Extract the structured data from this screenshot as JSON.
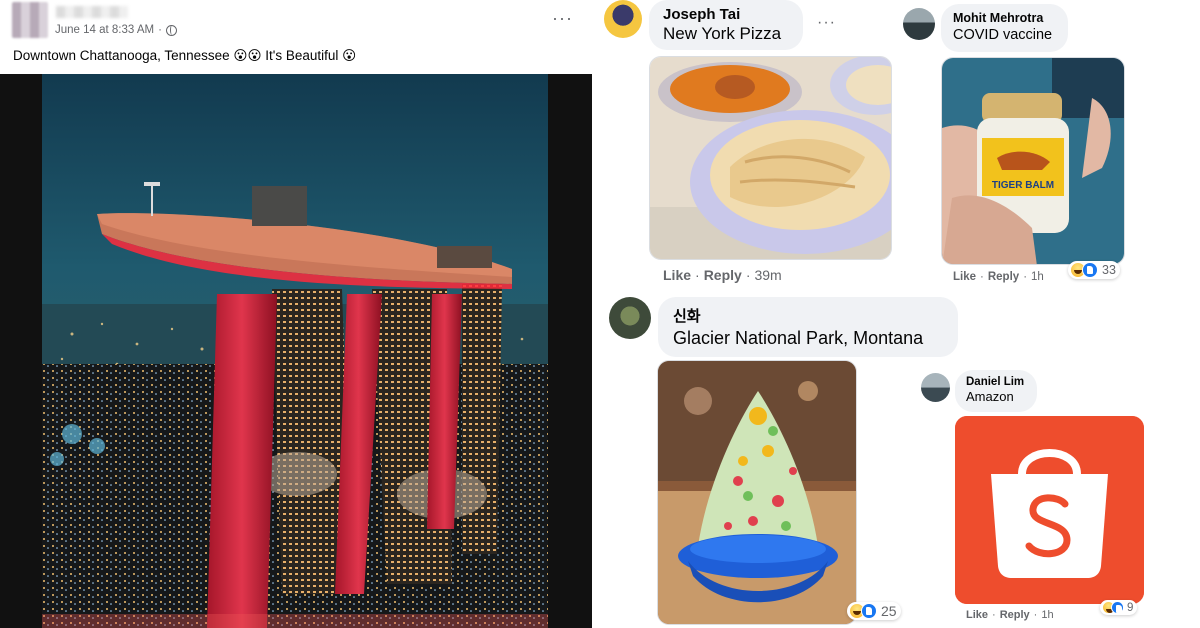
{
  "post": {
    "date_time": "June 14 at 8:33 AM",
    "separator": "·",
    "caption": "Downtown Chattanooga, Tennessee 😮😮 It's Beautiful 😮",
    "more_label": "···"
  },
  "comments": [
    {
      "name": "Joseph Tai",
      "text": "New York Pizza",
      "like_label": "Like",
      "reply_label": "Reply",
      "separator": "·",
      "time": "39m",
      "more_label": "···"
    },
    {
      "name": "Mohit Mehrotra",
      "text": "COVID vaccine",
      "like_label": "Like",
      "reply_label": "Reply",
      "separator": "·",
      "time": "1h",
      "reaction_count": "33"
    },
    {
      "name": "신화",
      "text": "Glacier National Park, Montana",
      "reaction_count": "25"
    },
    {
      "name": "Daniel Lim",
      "text": "Amazon",
      "like_label": "Like",
      "reply_label": "Reply",
      "separator": "·",
      "time": "1h",
      "reaction_count": "9"
    }
  ],
  "product_label_text": "TIGER BALM",
  "colors": {
    "brand_orange": "#ee4d2d",
    "facebook_blue": "#1877f2",
    "bubble_gray": "#f0f2f5",
    "meta_gray": "#65676b"
  }
}
